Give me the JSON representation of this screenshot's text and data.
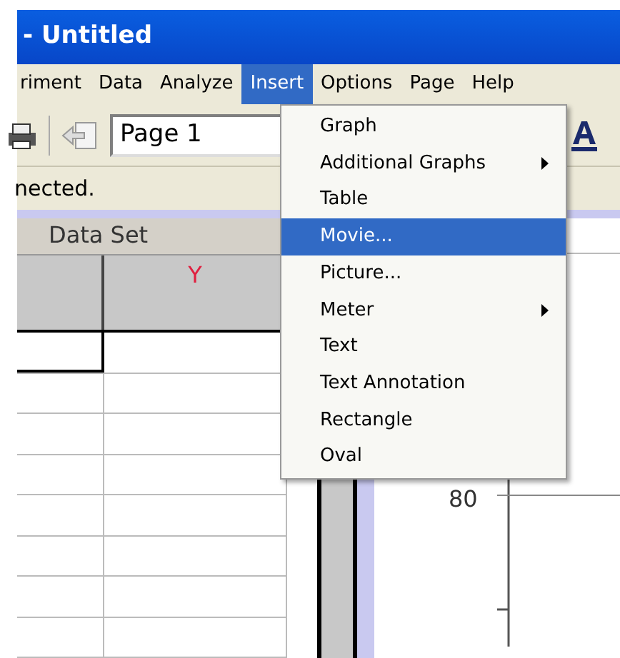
{
  "window": {
    "title": "- Untitled"
  },
  "menu_bar": [
    {
      "label": "riment",
      "selected": false
    },
    {
      "label": "Data",
      "selected": false
    },
    {
      "label": "Analyze",
      "selected": false
    },
    {
      "label": "Insert",
      "selected": true
    },
    {
      "label": "Options",
      "selected": false
    },
    {
      "label": "Page",
      "selected": false
    },
    {
      "label": "Help",
      "selected": false
    }
  ],
  "toolbar": {
    "page_field": "Page 1"
  },
  "status": "nected.",
  "table": {
    "title": "Data Set",
    "column_header": "Y",
    "rows": [
      {
        "selected": true
      },
      {
        "selected": false
      },
      {
        "selected": false
      },
      {
        "selected": false
      },
      {
        "selected": false
      },
      {
        "selected": false
      },
      {
        "selected": false
      },
      {
        "selected": false
      }
    ]
  },
  "graph": {
    "tick_label": "80"
  },
  "insert_menu": [
    {
      "label": "Graph",
      "selected": false,
      "submenu": false
    },
    {
      "label": "Additional Graphs",
      "selected": false,
      "submenu": true
    },
    {
      "label": "Table",
      "selected": false,
      "submenu": false
    },
    {
      "label": "Movie...",
      "selected": true,
      "submenu": false
    },
    {
      "label": "Picture...",
      "selected": false,
      "submenu": false
    },
    {
      "label": "Meter",
      "selected": false,
      "submenu": true
    },
    {
      "label": "Text",
      "selected": false,
      "submenu": false
    },
    {
      "label": "Text Annotation",
      "selected": false,
      "submenu": false
    },
    {
      "label": "Rectangle",
      "selected": false,
      "submenu": false
    },
    {
      "label": "Oval",
      "selected": false,
      "submenu": false
    }
  ]
}
